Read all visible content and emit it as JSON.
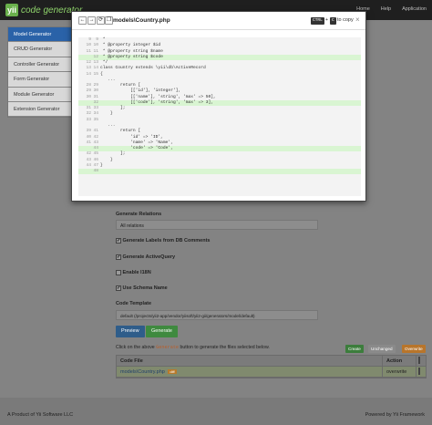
{
  "brand": {
    "logo": "yii",
    "name": "code generator"
  },
  "nav": {
    "home": "Home",
    "help": "Help",
    "application": "Application"
  },
  "sidebar": {
    "items": [
      {
        "label": "Model Generator",
        "active": true
      },
      {
        "label": "CRUD Generator",
        "active": false
      },
      {
        "label": "Controller Generator",
        "active": false
      },
      {
        "label": "Form Generator",
        "active": false
      },
      {
        "label": "Module Generator",
        "active": false
      },
      {
        "label": "Extension Generator",
        "active": false
      }
    ]
  },
  "form": {
    "generate_relations_label": "Generate Relations",
    "generate_relations_value": "All relations",
    "generate_labels_label": "Generate Labels from DB Comments",
    "generate_activequery_label": "Generate ActiveQuery",
    "enable_i18n_label": "Enable I18N",
    "use_schema_name_label": "Use Schema Name",
    "code_template_label": "Code Template",
    "code_template_value": "default (/projects/yii2-app/vendor/yiisoft/yii2-gii/generators/model/default)",
    "preview_label": "Preview",
    "generate_label": "Generate",
    "info_before": "Click on the above",
    "info_keyword": "Generate",
    "info_after": "button to generate the files selected below."
  },
  "legend": {
    "create": "Create",
    "unchanged": "Unchanged",
    "overwrite": "Overwrite"
  },
  "files_table": {
    "headers": {
      "file": "Code File",
      "action": "Action"
    },
    "rows": [
      {
        "file": "models\\Country.php",
        "badge": "diff",
        "action": "overwrite"
      }
    ]
  },
  "footer": {
    "left": "A Product of Yii Software LLC",
    "right": "Powered by Yii Framework"
  },
  "modal": {
    "back_icon": "←",
    "forward_icon": "→",
    "refresh_icon": "⟳",
    "copy_icon": "❐",
    "title": "models\\Country.php",
    "kbd_ctrl": "CTRL",
    "kbd_plus": "+",
    "kbd_c": "C",
    "copy_hint": "to copy",
    "close": "×",
    "diff_lines": [
      {
        "a": "9",
        "b": "9",
        "text": " *",
        "type": "ctx"
      },
      {
        "a": "10",
        "b": "10",
        "text": " * @property integer $id",
        "type": "ctx"
      },
      {
        "a": "11",
        "b": "11",
        "text": " * @property string $name",
        "type": "ctx"
      },
      {
        "a": "",
        "b": "12",
        "text": " * @property string $code",
        "type": "add"
      },
      {
        "a": "12",
        "b": "13",
        "text": " */",
        "type": "ctx"
      },
      {
        "a": "13",
        "b": "14",
        "text": "class Country extends \\yii\\db\\ActiveRecord",
        "type": "ctx"
      },
      {
        "a": "14",
        "b": "15",
        "text": "{",
        "type": "ctx"
      },
      {
        "a": "",
        "b": "",
        "text": "   ...",
        "type": "sep"
      },
      {
        "a": "28",
        "b": "29",
        "text": "        return [",
        "type": "ctx"
      },
      {
        "a": "29",
        "b": "30",
        "text": "            [['id'], 'integer'],",
        "type": "ctx"
      },
      {
        "a": "30",
        "b": "31",
        "text": "            [['name'], 'string', 'max' => 50],",
        "type": "ctx"
      },
      {
        "a": "",
        "b": "32",
        "text": "            [['code'], 'string', 'max' => 3],",
        "type": "add"
      },
      {
        "a": "31",
        "b": "33",
        "text": "        ];",
        "type": "ctx"
      },
      {
        "a": "32",
        "b": "34",
        "text": "    }",
        "type": "ctx"
      },
      {
        "a": "33",
        "b": "35",
        "text": "",
        "type": "ctx"
      },
      {
        "a": "",
        "b": "",
        "text": "   ...",
        "type": "sep"
      },
      {
        "a": "39",
        "b": "41",
        "text": "        return [",
        "type": "ctx"
      },
      {
        "a": "40",
        "b": "42",
        "text": "            'id' => 'ID',",
        "type": "ctx"
      },
      {
        "a": "41",
        "b": "43",
        "text": "            'name' => 'Name',",
        "type": "ctx"
      },
      {
        "a": "",
        "b": "44",
        "text": "            'code' => 'Code',",
        "type": "add"
      },
      {
        "a": "42",
        "b": "45",
        "text": "        ];",
        "type": "ctx"
      },
      {
        "a": "43",
        "b": "46",
        "text": "    }",
        "type": "ctx"
      },
      {
        "a": "44",
        "b": "47",
        "text": "}",
        "type": "ctx"
      },
      {
        "a": "",
        "b": "48",
        "text": "",
        "type": "add"
      }
    ]
  }
}
